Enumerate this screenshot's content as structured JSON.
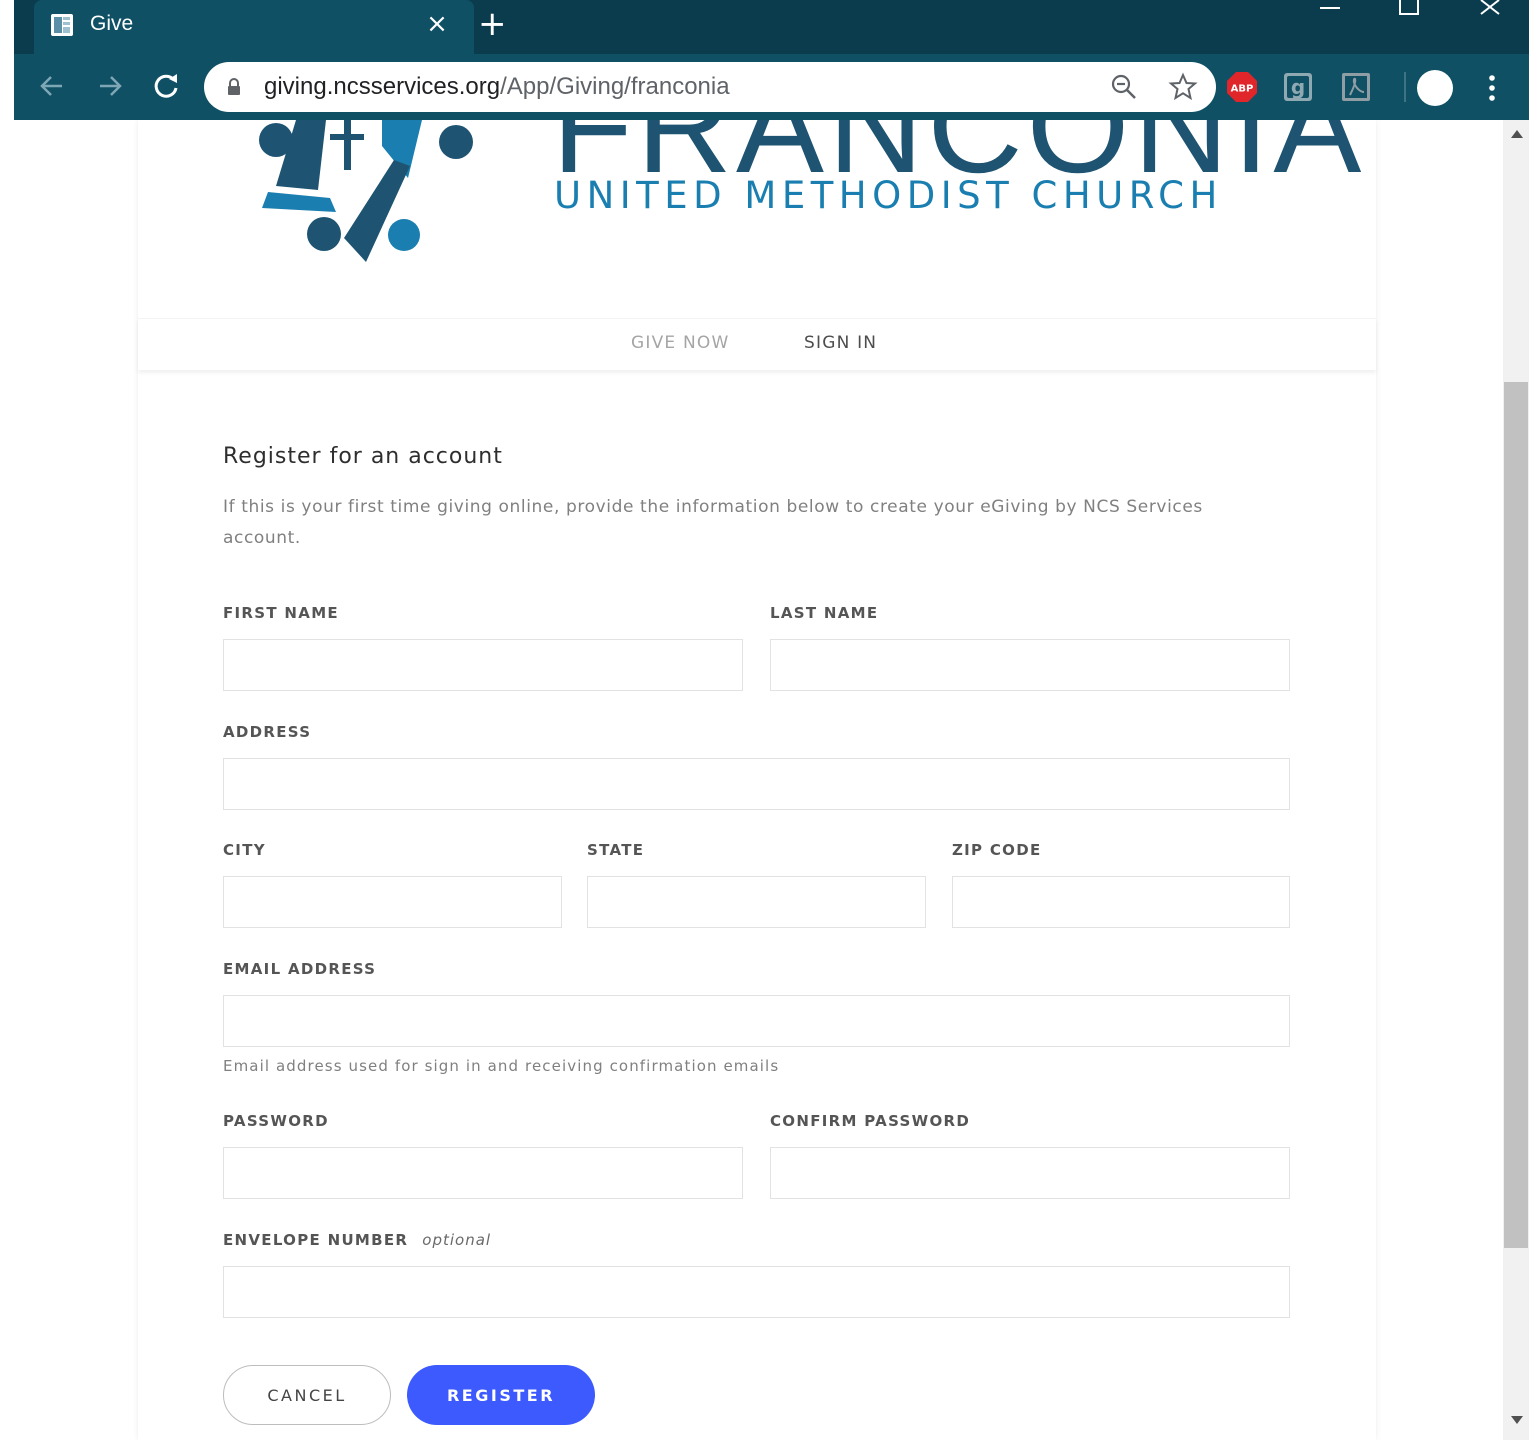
{
  "browser": {
    "tab_title": "Give",
    "tab_close": "×",
    "new_tab": "+",
    "url_host": "giving.ncsservices.org",
    "url_path": "/App/Giving/franconia",
    "extensions": [
      "adblock-plus",
      "grammarly",
      "acrobat"
    ],
    "ext_abp_label": "ABP",
    "ext_g_label": "g"
  },
  "header": {
    "logo_name": "FRANCONIA",
    "logo_subtitle": "UNITED METHODIST CHURCH"
  },
  "nav": {
    "give_now": "GIVE NOW",
    "sign_in": "SIGN IN"
  },
  "form": {
    "title": "Register for an account",
    "description": "If this is your first time giving online, provide the information below to create your eGiving by NCS Services account.",
    "first_name_label": "FIRST NAME",
    "last_name_label": "LAST NAME",
    "address_label": "ADDRESS",
    "city_label": "CITY",
    "state_label": "STATE",
    "zip_label": "ZIP CODE",
    "email_label": "EMAIL ADDRESS",
    "email_help": "Email address used for sign in and receiving confirmation emails",
    "password_label": "PASSWORD",
    "confirm_password_label": "CONFIRM PASSWORD",
    "envelope_label": "ENVELOPE NUMBER",
    "envelope_optional": "optional",
    "cancel_label": "CANCEL",
    "register_label": "REGISTER"
  },
  "colors": {
    "chrome_frame": "#0b3c4e",
    "chrome_toolbar": "#0f5064",
    "logo_dark": "#1e5472",
    "logo_light": "#1a7fb0",
    "register_button": "#3d5afe"
  }
}
